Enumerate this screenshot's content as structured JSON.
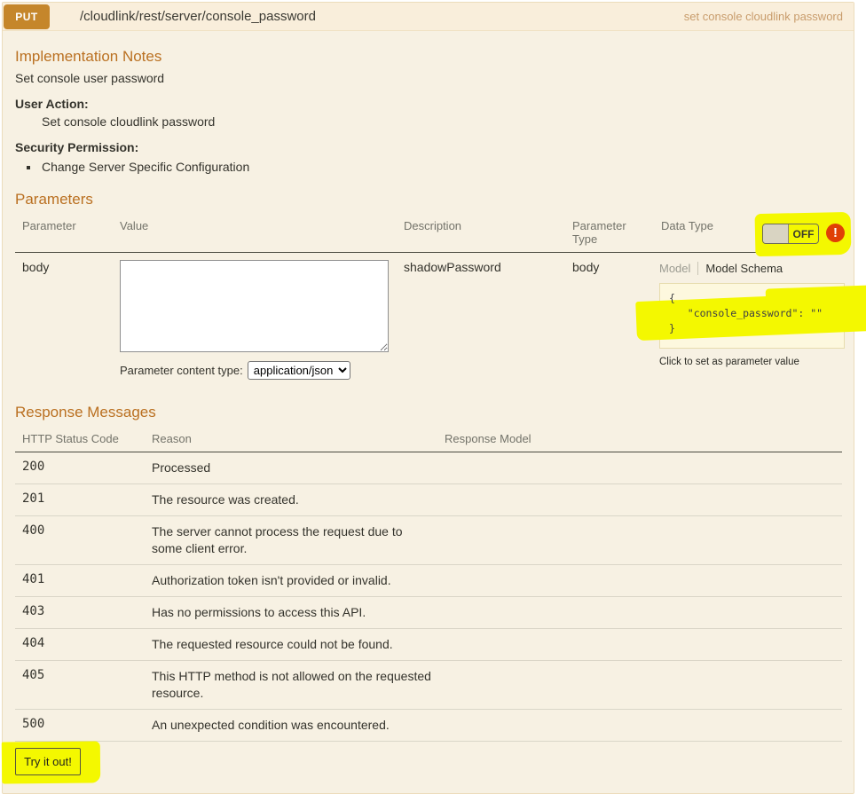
{
  "header": {
    "method": "PUT",
    "path": "/cloudlink/rest/server/console_password",
    "summary": "set console cloudlink password"
  },
  "implementation_notes": {
    "title": "Implementation Notes",
    "description": "Set console user password",
    "user_action_label": "User Action:",
    "user_action_value": "Set console cloudlink password",
    "security_permission_label": "Security Permission:",
    "security_permissions": {
      "0": "Change Server Specific Configuration"
    }
  },
  "auth_toggle": {
    "state": "OFF",
    "warning_glyph": "!"
  },
  "parameters": {
    "title": "Parameters",
    "columns": {
      "0": "Parameter",
      "1": "Value",
      "2": "Description",
      "3": "Parameter Type",
      "4": "Data Type"
    },
    "rows": {
      "0": {
        "name": "body",
        "value": "",
        "description": "shadowPassword",
        "parameter_type": "body",
        "content_type_label": "Parameter content type:",
        "content_type_value": "application/json",
        "model_tab": "Model",
        "model_schema_tab": "Model Schema",
        "schema_json_lines": {
          "0": "{",
          "1": "   \"console_password\": \"\"",
          "2": "}"
        },
        "schema_hint": "Click to set as parameter value"
      }
    }
  },
  "responses": {
    "title": "Response Messages",
    "columns": {
      "0": "HTTP Status Code",
      "1": "Reason",
      "2": "Response Model"
    },
    "rows": {
      "0": {
        "code": "200",
        "reason": "Processed",
        "model": ""
      },
      "1": {
        "code": "201",
        "reason": "The resource was created.",
        "model": ""
      },
      "2": {
        "code": "400",
        "reason": "The server cannot process the request due to some client error.",
        "model": ""
      },
      "3": {
        "code": "401",
        "reason": "Authorization token isn't provided or invalid.",
        "model": ""
      },
      "4": {
        "code": "403",
        "reason": "Has no permissions to access this API.",
        "model": ""
      },
      "5": {
        "code": "404",
        "reason": "The requested resource could not be found.",
        "model": ""
      },
      "6": {
        "code": "405",
        "reason": "This HTTP method is not allowed on the requested resource.",
        "model": ""
      },
      "7": {
        "code": "500",
        "reason": "An unexpected condition was encountered.",
        "model": ""
      }
    }
  },
  "actions": {
    "try_it_out": "Try it out!"
  },
  "colors": {
    "method_badge": "#c5862b",
    "section_title": "#ba7021",
    "panel_background": "#f7f1e3",
    "highlighter": "#f4f800",
    "warning_icon": "#e04006",
    "schema_panel": "#fdf8de"
  }
}
